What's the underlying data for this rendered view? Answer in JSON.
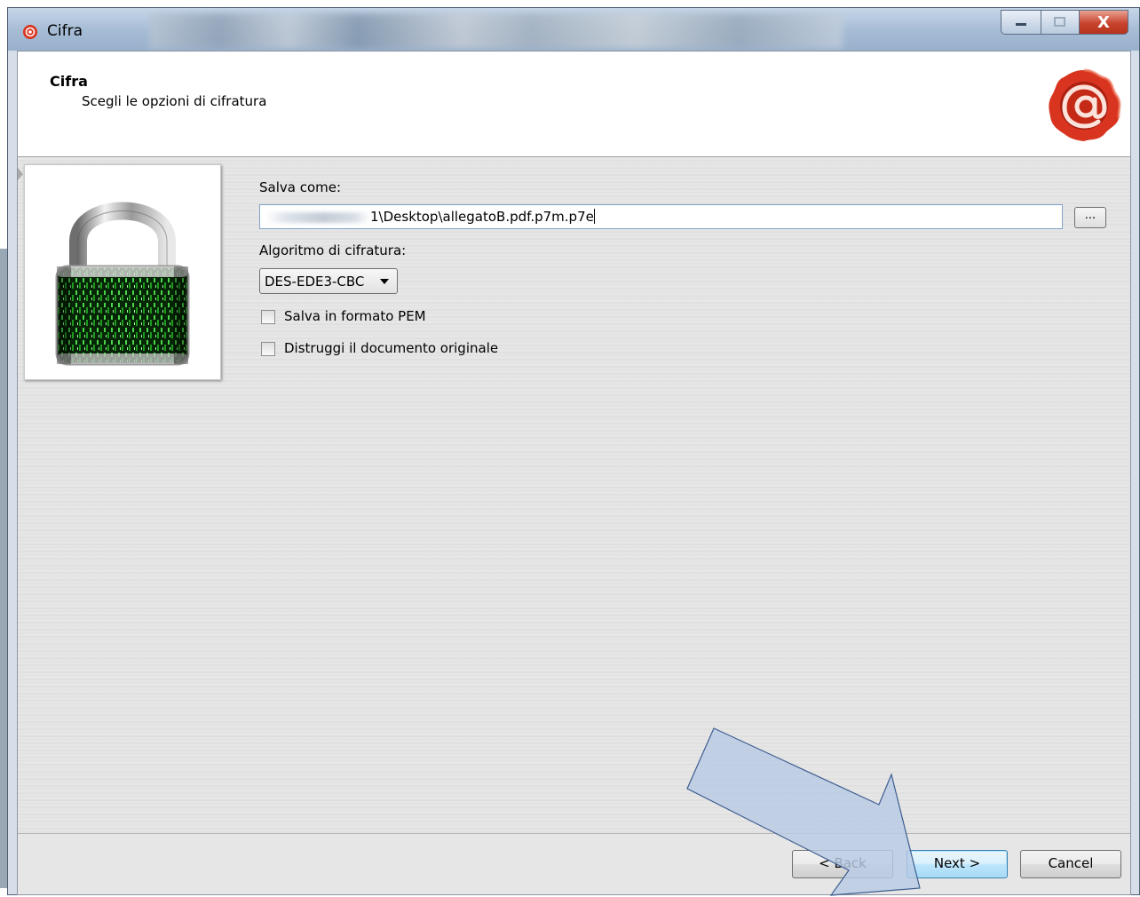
{
  "window": {
    "title": "Cifra",
    "controls": [
      "minimize",
      "maximize",
      "close"
    ],
    "close_label": "X"
  },
  "header": {
    "title": "Cifra",
    "subtitle": "Scegli le opzioni di cifratura"
  },
  "form": {
    "save_as_label": "Salva come:",
    "save_as_value": "1\\Desktop\\allegatoB.pdf.p7m.p7e",
    "browse_label": "...",
    "algorithm_label": "Algoritmo di cifratura:",
    "algorithm_value": "DES-EDE3-CBC",
    "pem_label": "Salva in formato PEM",
    "pem_checked": false,
    "destroy_label": "Distruggi il documento originale",
    "destroy_checked": false
  },
  "footer": {
    "back_label": "< Back",
    "next_label": "Next >",
    "cancel_label": "Cancel"
  },
  "colors": {
    "accent_arrow": "#b8cbe4",
    "arrow_stroke": "#3e5e90",
    "seal_red": "#d8341f"
  }
}
